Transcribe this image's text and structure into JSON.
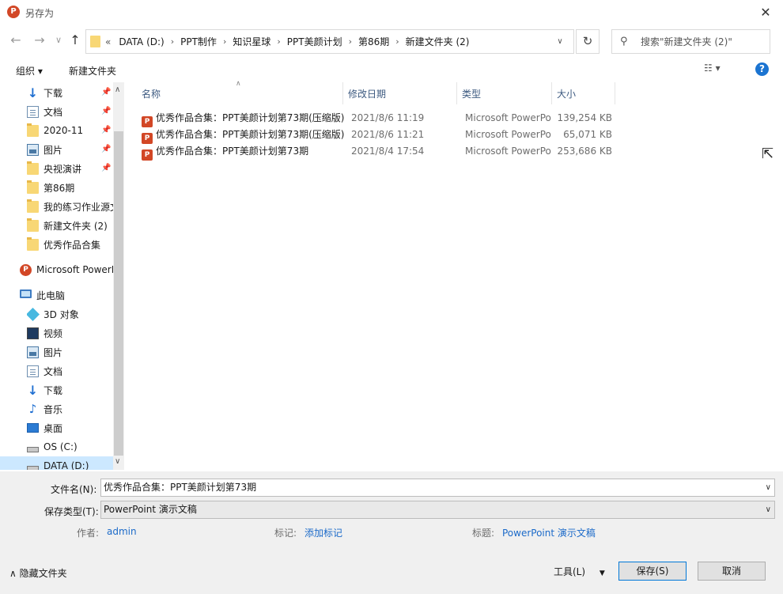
{
  "window": {
    "title": "另存为",
    "app_icon_letter": "P",
    "close_glyph": "✕"
  },
  "nav": {
    "back_glyph": "←",
    "forward_glyph": "→",
    "recent_glyph": "∨",
    "up_glyph": "↑",
    "address_prefix": "«",
    "breadcrumb": [
      "DATA (D:)",
      "PPT制作",
      "知识星球",
      "PPT美颜计划",
      "第86期",
      "新建文件夹 (2)"
    ],
    "address_dropdown_glyph": "∨",
    "refresh_glyph": "↻",
    "search_placeholder": "搜索\"新建文件夹 (2)\""
  },
  "toolbar": {
    "organize": "组织 ▾",
    "new_folder": "新建文件夹",
    "view_glyph": "☷ ▾",
    "help": "?"
  },
  "sidebar": {
    "quick_access": [
      {
        "label": "下载",
        "icon": "download-icon",
        "pinned": true
      },
      {
        "label": "文档",
        "icon": "document-icon",
        "pinned": true
      },
      {
        "label": "2020-11",
        "icon": "folder-icon",
        "pinned": true
      },
      {
        "label": "图片",
        "icon": "pictures-icon",
        "pinned": true
      },
      {
        "label": "央视演讲",
        "icon": "folder-icon",
        "pinned": true
      },
      {
        "label": "第86期",
        "icon": "folder-icon",
        "pinned": false
      },
      {
        "label": "我的练习作业源文件",
        "icon": "folder-icon",
        "pinned": false
      },
      {
        "label": "新建文件夹 (2)",
        "icon": "folder-icon",
        "pinned": false
      },
      {
        "label": "优秀作品合集",
        "icon": "folder-icon",
        "pinned": false
      }
    ],
    "powerpoint": "Microsoft PowerPoint",
    "this_pc": "此电脑",
    "pc_items": [
      {
        "label": "3D 对象",
        "icon": "3d-objects-icon"
      },
      {
        "label": "视频",
        "icon": "video-icon"
      },
      {
        "label": "图片",
        "icon": "pictures-icon"
      },
      {
        "label": "文档",
        "icon": "document-icon"
      },
      {
        "label": "下载",
        "icon": "download-icon"
      },
      {
        "label": "音乐",
        "icon": "music-icon"
      },
      {
        "label": "桌面",
        "icon": "desktop-icon"
      },
      {
        "label": "OS (C:)",
        "icon": "drive-icon"
      },
      {
        "label": "DATA (D:)",
        "icon": "drive-icon"
      }
    ],
    "pin_glyph": "📌"
  },
  "columns": {
    "name": "名称",
    "date": "修改日期",
    "type": "类型",
    "size": "大小"
  },
  "files": [
    {
      "name": "优秀作品合集：PPT美颜计划第73期(压缩版)",
      "date": "2021/8/6 11:19",
      "type": "Microsoft PowerPoint 演示文稿",
      "size": "139,254 KB"
    },
    {
      "name": "优秀作品合集：PPT美颜计划第73期(压缩版)",
      "date": "2021/8/6 11:21",
      "type": "Microsoft PowerPoint 演示文稿",
      "size": "65,071 KB"
    },
    {
      "name": "优秀作品合集：PPT美颜计划第73期",
      "date": "2021/8/4 17:54",
      "type": "Microsoft PowerPoint 演示文稿",
      "size": "253,686 KB"
    }
  ],
  "form": {
    "filename_label": "文件名(N):",
    "filename_value": "优秀作品合集：PPT美颜计划第73期",
    "filetype_label": "保存类型(T):",
    "filetype_value": "PowerPoint 演示文稿",
    "author_label": "作者:",
    "author_value": "admin",
    "tags_label": "标记:",
    "tags_value": "添加标记",
    "title_label": "标题:",
    "title_value": "PowerPoint 演示文稿"
  },
  "footer": {
    "hide_folders": "隐藏文件夹",
    "tools": "工具(L)",
    "save": "保存(S)",
    "cancel": "取消"
  },
  "colors": {
    "accent": "#0078d7",
    "link": "#1b6ac9",
    "powerpoint": "#d24726",
    "folder": "#f8d775"
  }
}
